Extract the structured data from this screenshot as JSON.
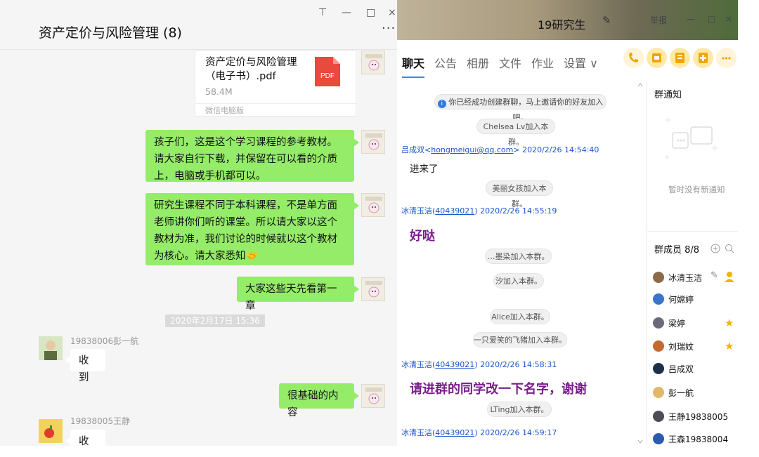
{
  "wechat": {
    "title": "资产定价与风险管理 (8)",
    "window_controls": {
      "pin": "⊤",
      "min": "—",
      "max": "□",
      "close": "×"
    },
    "more": "···",
    "file": {
      "name": "资产定价与风险管理（电子书）.pdf",
      "size": "58.4M",
      "source": "微信电脑版",
      "badge": "PDF"
    },
    "messages": [
      {
        "text": "孩子们，这是这个学习课程的参考教材。请大家自行下载，并保留在可以看的介质上，电脑或手机都可以。"
      },
      {
        "text": "研究生课程不同于本科课程，不是单方面老师讲你们听的课堂。所以请大家以这个教材为准，我们讨论的时候就以这个教材为核心。请大家悉知"
      },
      {
        "text": "大家这些天先看第一章"
      }
    ],
    "timestamp": "2020年2月17日 15:36",
    "reply1": {
      "nick": "19838006彭一航",
      "text": "收到"
    },
    "msg_basic": {
      "text": "很基础的内容"
    },
    "reply2": {
      "nick": "19838005王静",
      "text": "收到"
    }
  },
  "qq": {
    "title": "19研究生",
    "edit_icon": "✎",
    "controls": {
      "report": "举报",
      "min": "—",
      "max": "□",
      "close": "×"
    },
    "tabs": [
      "聊天",
      "公告",
      "相册",
      "文件",
      "作业",
      "设置 ∨"
    ],
    "chat": {
      "system_created": "你已经成功创建群聊，马上邀请你的好友加入吧。",
      "join1": "Chelsea Lv加入本群。",
      "msg1_sender": "吕成双<",
      "msg1_email": "hongmeigui@qq.com",
      "msg1_time": "> 2020/2/26 14:54:40",
      "msg1_text": "进来了",
      "join2": "美丽女孩加入本群。",
      "msg2_sender": "冰清玉洁(",
      "msg2_qq": "40439021",
      "msg2_time": ") 2020/2/26 14:55:19",
      "msg2_text": "好哒",
      "join3": "…墨染加入本群。",
      "join4": "汐加入本群。",
      "join5": "Alice加入本群。",
      "join6": "一只爱笑的飞猪加入本群。",
      "msg3_sender": "冰清玉洁(",
      "msg3_qq": "40439021",
      "msg3_time": ") 2020/2/26 14:58:31",
      "msg3_text": "请进群的同学改一下名字，谢谢",
      "join7": "LTing加入本群。",
      "msg4_sender": "冰清玉洁(",
      "msg4_qq": "40439021",
      "msg4_time": ") 2020/2/26 14:59:17"
    },
    "sidebar": {
      "notice_title": "群通知",
      "no_notice": "暂时没有新通知",
      "members_title": "群成员 8/8",
      "members": [
        "冰清玉洁",
        "何嫦婷",
        "梁婷",
        "刘瑞妏",
        "吕成双",
        "彭一航",
        "王静19838005",
        "王森19838004"
      ]
    }
  }
}
